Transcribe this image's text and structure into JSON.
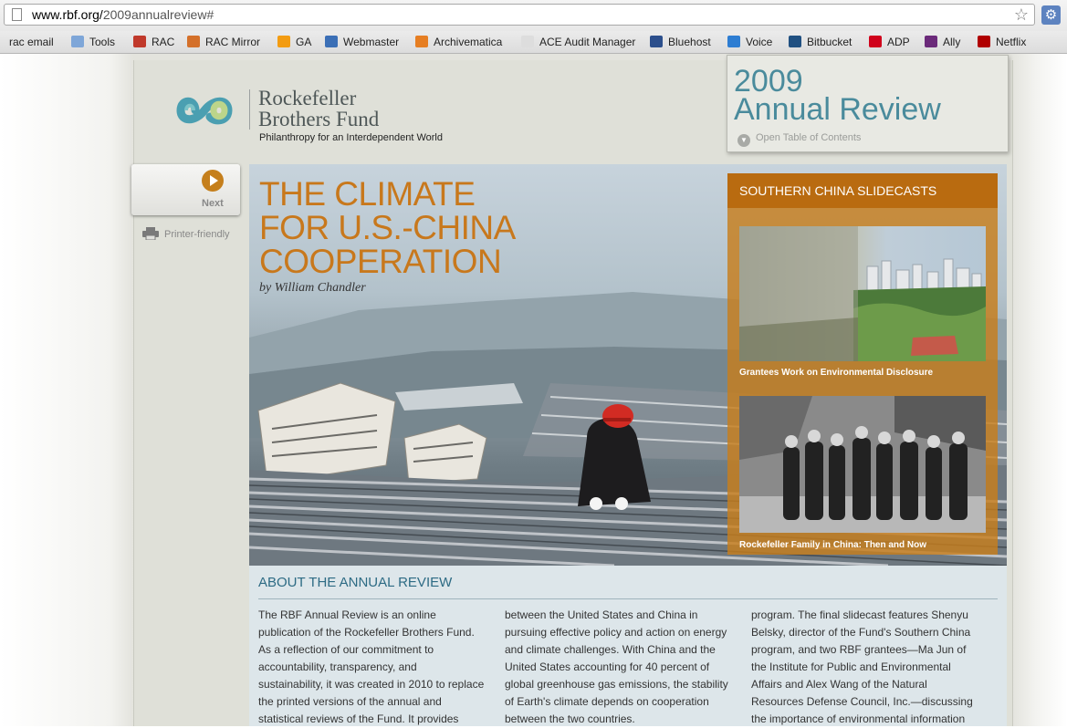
{
  "browser": {
    "url_domain": "www.rbf.org/",
    "url_path": "2009annualreview#",
    "bookmarks": [
      {
        "label": "rac email",
        "color": "#5b8dd6"
      },
      {
        "label": "Tools",
        "color": "#7ea6d8"
      },
      {
        "label": "RAC",
        "color": "#c0392b"
      },
      {
        "label": "RAC Mirror",
        "color": "#d4702a"
      },
      {
        "label": "GA",
        "color": "#f39c12"
      },
      {
        "label": "Webmaster",
        "color": "#3b6fb6"
      },
      {
        "label": "Archivematica",
        "color": "#e67e22"
      },
      {
        "label": "ACE Audit Manager",
        "color": "#dddddd"
      },
      {
        "label": "Bluehost",
        "color": "#2c4f8c"
      },
      {
        "label": "Voice",
        "color": "#2d7dd2"
      },
      {
        "label": "Bitbucket",
        "color": "#205081"
      },
      {
        "label": "ADP",
        "color": "#d0021b"
      },
      {
        "label": "Ally",
        "color": "#6b2a7a"
      },
      {
        "label": "Netflix",
        "color": "#b00000"
      }
    ]
  },
  "site": {
    "logo_line1": "Rockefeller",
    "logo_line2": "Brothers Fund",
    "tagline": "Philanthropy for an Interdependent World"
  },
  "annual_review": {
    "line1": "2009",
    "line2": "Annual Review",
    "toc_label": "Open Table of Contents"
  },
  "nav": {
    "next_label": "Next",
    "printer_label": "Printer-friendly"
  },
  "hero": {
    "title_line1": "THE CLIMATE",
    "title_line2": "FOR U.S.-CHINA",
    "title_line3": "COOPERATION",
    "byline": "by William Chandler"
  },
  "slidecasts": {
    "heading": "SOUTHERN CHINA SLIDECASTS",
    "items": [
      {
        "caption": "Grantees Work on Environmental Disclosure"
      },
      {
        "caption": "Rockefeller Family in China: Then and Now"
      }
    ]
  },
  "about": {
    "title": "ABOUT THE ANNUAL REVIEW",
    "columns": [
      {
        "lines": [
          "The RBF Annual Review is an online",
          "publication of the Rockefeller Brothers Fund.",
          "As a reflection of our commitment to",
          "accountability, transparency, and",
          "sustainability, it was created in 2010 to replace",
          "the printed versions of the annual and",
          "statistical reviews of the Fund. It provides"
        ]
      },
      {
        "lines": [
          "between the United States and China in",
          "pursuing effective policy and action on energy",
          "and climate challenges. With China and the",
          "United States accounting for 40 percent of",
          "global greenhouse gas emissions, the stability",
          "of Earth's climate depends on cooperation",
          "between the two countries."
        ]
      },
      {
        "lines": [
          "program.  The final slidecast features Shenyu",
          "Belsky, director of the Fund's Southern China",
          "program, and two RBF grantees—Ma Jun of",
          "the Institute for Public and Environmental",
          "Affairs and Alex Wang of the Natural",
          "Resources Defense Council, Inc.—discussing",
          "the importance of environmental information"
        ]
      }
    ]
  },
  "colors": {
    "accent_orange": "#c8781c",
    "annual_review_teal": "#4a8b9c",
    "about_title_blue": "#2d6b84"
  }
}
